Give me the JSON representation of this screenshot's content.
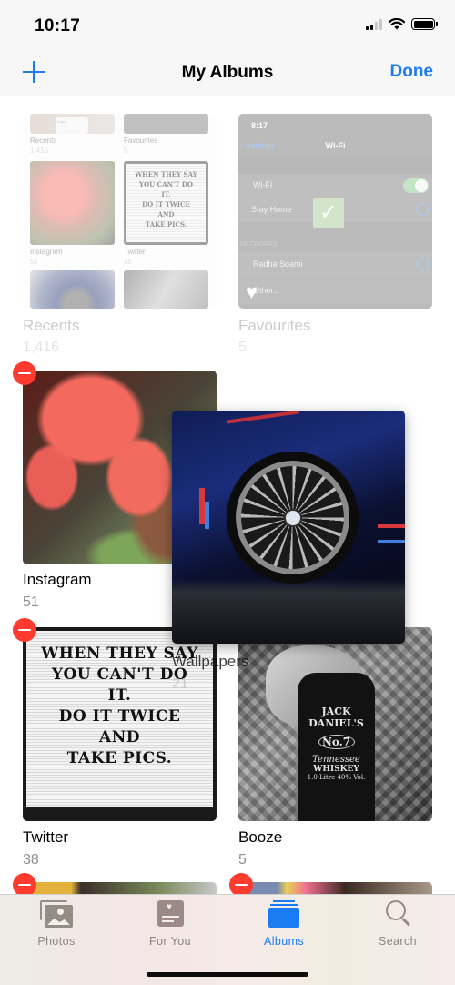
{
  "status_bar": {
    "time": "10:17",
    "signal": "signal-icon",
    "wifi": "wifi-icon",
    "battery": "battery-icon"
  },
  "nav": {
    "add_icon": "plus-icon",
    "title": "My Albums",
    "done_label": "Done"
  },
  "colors": {
    "accent": "#1a7cf5",
    "delete": "#ff3b30",
    "count_gray": "#8e8e93"
  },
  "albums": [
    {
      "name": "Recents",
      "count": "1,416",
      "state": "faded"
    },
    {
      "name": "Favourites",
      "count": "5",
      "state": "faded"
    },
    {
      "name": "Instagram",
      "count": "51",
      "deletable": true
    },
    {
      "name": "Wallpapers",
      "count": "21",
      "state": "dragging"
    },
    {
      "name": "Twitter",
      "count": "38",
      "deletable": true
    },
    {
      "name": "Booze",
      "count": "5",
      "deletable": true
    }
  ],
  "recents_preview": {
    "items": [
      {
        "name": "Recents",
        "count": "1,415"
      },
      {
        "name": "Favourites",
        "count": "5"
      },
      {
        "name": "Instagram",
        "count": "51"
      },
      {
        "name": "Twitter",
        "count": "38"
      }
    ],
    "menu_items": [
      "Copy",
      "Share"
    ]
  },
  "favourites_preview": {
    "time": "8:17",
    "back_label": "Settings",
    "title": "Wi-Fi",
    "wifi_label": "Wi-Fi",
    "connected_network": "Stay Home",
    "section_header": "NETWORKS",
    "networks": [
      "Radha Soami",
      "Other..."
    ]
  },
  "twitter_board": [
    "WHEN THEY SAY",
    "YOU CAN'T DO",
    "IT.",
    "DO IT TWICE",
    "AND",
    "TAKE PICS."
  ],
  "booze_label": [
    "JACK DANIEL'S",
    "No.7",
    "Tennessee",
    "WHISKEY",
    "1.0 Litre 40% Vol."
  ],
  "tab_bar": {
    "tabs": [
      {
        "label": "Photos",
        "icon": "photos-icon",
        "active": false
      },
      {
        "label": "For You",
        "icon": "for-you-icon",
        "active": false
      },
      {
        "label": "Albums",
        "icon": "albums-icon",
        "active": true
      },
      {
        "label": "Search",
        "icon": "search-icon",
        "active": false
      }
    ]
  }
}
